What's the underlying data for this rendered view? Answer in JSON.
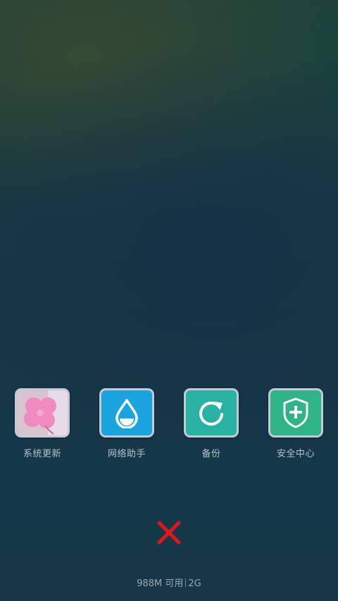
{
  "apps": [
    {
      "label": "系统更新",
      "icon": "flower-update-icon"
    },
    {
      "label": "网络助手",
      "icon": "water-drop-icon"
    },
    {
      "label": "备份",
      "icon": "refresh-icon"
    },
    {
      "label": "安全中心",
      "icon": "shield-plus-icon"
    }
  ],
  "close": {
    "icon": "close-icon",
    "color": "#e8141c"
  },
  "status": {
    "memory": "988M 可用",
    "total": "2G"
  }
}
